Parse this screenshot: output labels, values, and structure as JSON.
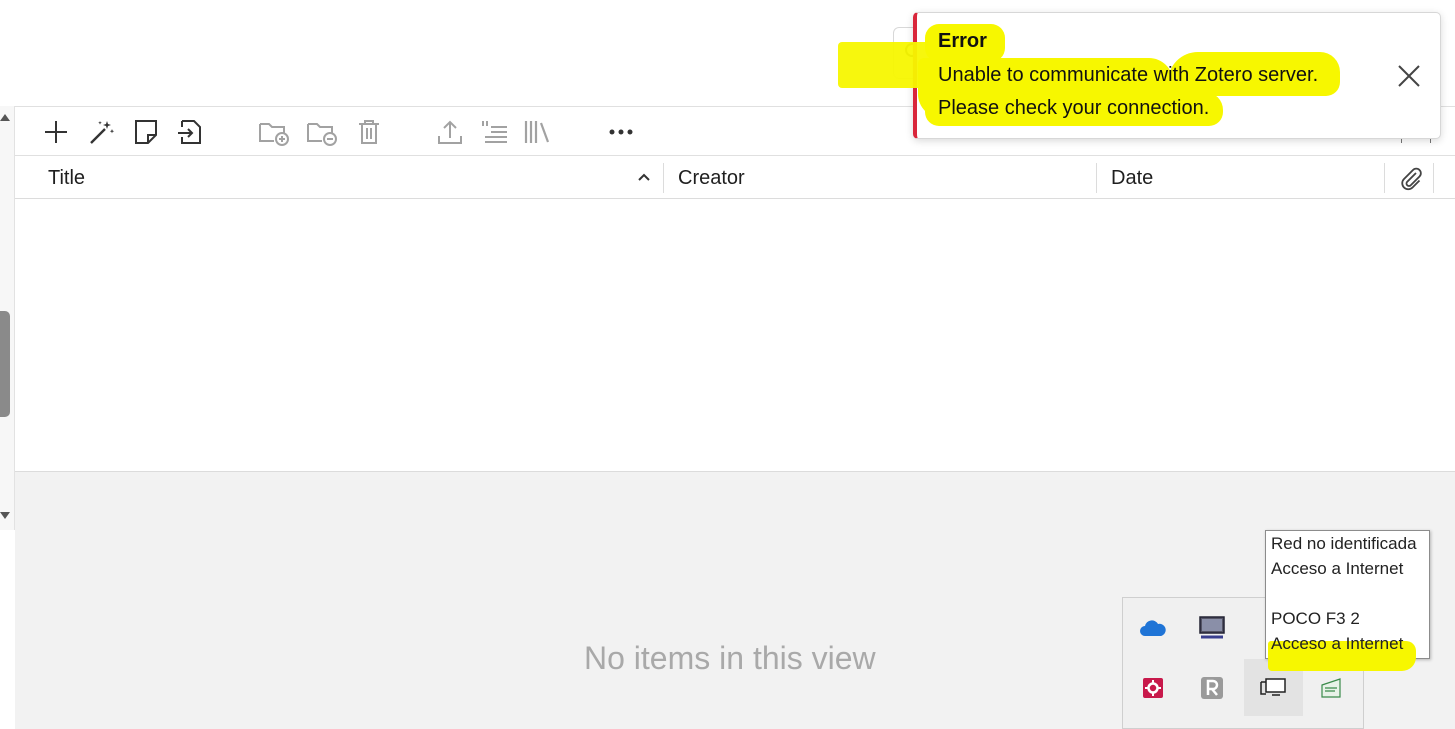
{
  "toolbar": {
    "buttons": [
      "new-item",
      "add-by-identifier",
      "new-note",
      "add-attachment",
      "new-collection",
      "remove-from-collection",
      "trash",
      "export",
      "create-bibliography",
      "library-view",
      "more"
    ]
  },
  "columns": {
    "title": "Title",
    "creator": "Creator",
    "date": "Date",
    "sort_indicator": "ascending"
  },
  "items_pane": {
    "empty_message": "No items in this view"
  },
  "notification": {
    "title": "Error",
    "line1": "Unable to communicate with Zotero server.",
    "line2": "Please check your connection.",
    "accent_color": "#d9263b"
  },
  "tooltip": {
    "network1_name": "Red no identificada",
    "network1_status": "Acceso a Internet",
    "network2_name": "POCO F3 2",
    "network2_status": "Acceso a Internet"
  },
  "tray": {
    "icons": [
      "onedrive-icon",
      "display-icon",
      "security-icon",
      "r-app-icon",
      "network-icon",
      "battery-icon"
    ]
  },
  "highlight_color": "#f7f700"
}
